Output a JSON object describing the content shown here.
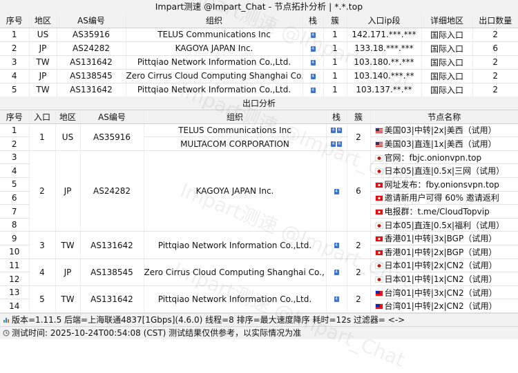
{
  "title": "Impart测速 @Impart_Chat - 节点拓扑分析 | *.*.top",
  "watermark": "Impart测速 @Impart_Chat",
  "inbound": {
    "headers": [
      "序号",
      "地区",
      "AS编号",
      "组织",
      "栈",
      "簇",
      "入口ip段",
      "详细地区",
      "出口数量"
    ],
    "rows": [
      {
        "id": "1",
        "region": "US",
        "asn": "AS35916",
        "org": "TELUS Communications Inc",
        "stack": "4",
        "cluster": "1",
        "ip": "142.171.***.***",
        "detail": "国际入口",
        "count": "2"
      },
      {
        "id": "2",
        "region": "JP",
        "asn": "AS24282",
        "org": "KAGOYA JAPAN Inc.",
        "stack": "4",
        "cluster": "1",
        "ip": "133.18.***.***",
        "detail": "国际入口",
        "count": "6"
      },
      {
        "id": "3",
        "region": "TW",
        "asn": "AS131642",
        "org": "Pittqiao Network Information Co.,Ltd.",
        "stack": "4",
        "cluster": "1",
        "ip": "103.180.**.***",
        "detail": "国际入口",
        "count": "2"
      },
      {
        "id": "4",
        "region": "JP",
        "asn": "AS138545",
        "org": "Zero Cirrus Cloud Computing Shanghai Co., Ltd.",
        "stack": "4",
        "cluster": "1",
        "ip": "103.140.***.**",
        "detail": "国际入口",
        "count": "2"
      },
      {
        "id": "5",
        "region": "TW",
        "asn": "AS131642",
        "org": "Pittqiao Network Information Co.,Ltd.",
        "stack": "4",
        "cluster": "1",
        "ip": "103.137.**.**",
        "detail": "国际入口",
        "count": "2"
      }
    ]
  },
  "outbound": {
    "section_title": "出口分析",
    "headers": [
      "序号",
      "入口",
      "地区",
      "AS编号",
      "组织",
      "栈",
      "簇",
      "节点名称"
    ],
    "groups": [
      {
        "entry": "1",
        "region": "US",
        "asn": "AS35916",
        "cluster": "2",
        "orgs": [
          {
            "name": "TELUS Communications Inc",
            "span": 1,
            "stack": [
              "4",
              "6"
            ]
          },
          {
            "name": "MULTACOM CORPORATION",
            "span": 1,
            "stack": [
              "4",
              "6"
            ]
          }
        ],
        "rows": [
          {
            "id": "1",
            "flag": "us",
            "node": "美国03|中转|2x|美西（试用）"
          },
          {
            "id": "2",
            "flag": "us",
            "node": "美国03|直连|1x|美西（试用）"
          }
        ]
      },
      {
        "entry": "2",
        "region": "JP",
        "asn": "AS24282",
        "cluster": "6",
        "orgs": [
          {
            "name": "KAGOYA JAPAN Inc.",
            "span": 6,
            "stack": [
              "4"
            ]
          }
        ],
        "rows": [
          {
            "id": "3",
            "flag": "jp",
            "node": "官网：fbjc.onionvpn.top"
          },
          {
            "id": "4",
            "flag": "jp",
            "node": "日本05|直连|0.5x|三网（试用）"
          },
          {
            "id": "5",
            "flag": "hk",
            "node": "网址发布：fby.onionsvpn.top"
          },
          {
            "id": "6",
            "flag": "hk",
            "node": "邀请新用户可得 60% 邀请返利"
          },
          {
            "id": "7",
            "flag": "hk",
            "node": "电报群：t.me/CloudTopvip"
          },
          {
            "id": "8",
            "flag": "jp",
            "node": "日本05|直连|0.5x|福利（试用）"
          }
        ]
      },
      {
        "entry": "3",
        "region": "TW",
        "asn": "AS131642",
        "cluster": "2",
        "orgs": [
          {
            "name": "Pittqiao Network Information Co.,Ltd.",
            "span": 2,
            "stack": [
              "4"
            ]
          }
        ],
        "rows": [
          {
            "id": "9",
            "flag": "hk",
            "node": "香港01|中转|3x|BGP（试用）"
          },
          {
            "id": "10",
            "flag": "hk",
            "node": "香港01|中转|2x|BGP（试用）"
          }
        ]
      },
      {
        "entry": "4",
        "region": "JP",
        "asn": "AS138545",
        "cluster": "2",
        "orgs": [
          {
            "name": "Zero Cirrus Cloud Computing Shanghai Co., Ltd.",
            "span": 2,
            "stack": [
              "4"
            ]
          }
        ],
        "rows": [
          {
            "id": "11",
            "flag": "jp",
            "node": "日本01|中转|2x|CN2（试用）"
          },
          {
            "id": "12",
            "flag": "jp",
            "node": "日本01|中转|1x|CN2（试用）"
          }
        ]
      },
      {
        "entry": "5",
        "region": "TW",
        "asn": "AS131642",
        "cluster": "2",
        "orgs": [
          {
            "name": "Pittqiao Network Information Co.,Ltd.",
            "span": 2,
            "stack": [
              "4"
            ]
          }
        ],
        "rows": [
          {
            "id": "13",
            "flag": "tw",
            "node": "台湾01|中转|3x|CN2（试用）"
          },
          {
            "id": "14",
            "flag": "tw",
            "node": "台湾01|中转|2x|CN2（试用）"
          }
        ]
      }
    ]
  },
  "status": {
    "line1": "版本=1.11.5  后端=上海联通4837[1Gbps](4.6.0)  线程=8  排序=最大速度降序  耗时=12s  过滤器= <->",
    "line2": "测试时间: 2025-10-24T00:54:08 (CST)  测试结果仅供参考，以实际情况为准"
  },
  "colors": {
    "badge": "#3f72c8",
    "header_bg": "#f2f2f2"
  }
}
